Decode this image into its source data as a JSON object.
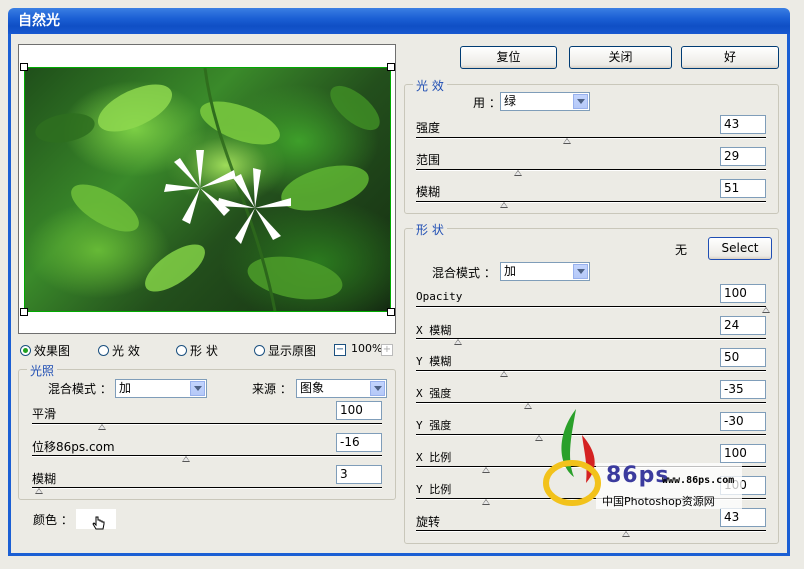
{
  "window": {
    "title": "自然光"
  },
  "buttons": {
    "reset": "复位",
    "close": "关闭",
    "ok": "好",
    "select": "Select"
  },
  "view_options": {
    "items": [
      "效果图",
      "光 效",
      "形 状",
      "显示原图"
    ],
    "selected": 0,
    "zoom": "100%"
  },
  "lighting": {
    "title": "光照",
    "blend_label": "混合模式 ：",
    "blend_value": "加",
    "source_label": "来源 ：",
    "source_value": "图象",
    "smooth_label": "平滑",
    "smooth_value": "100",
    "smooth_level": 0.2,
    "offset_label": "位移86ps.com",
    "offset_value": "-16",
    "offset_level": 0.44,
    "blur_label": "模糊",
    "blur_value": "3",
    "blur_level": 0.02
  },
  "color": {
    "label": "颜色 ：",
    "value": "#ffffff"
  },
  "light_effect": {
    "title": "光 效",
    "use_label": "用 ：",
    "use_value": "绿",
    "intensity_label": "强度",
    "intensity_value": "43",
    "intensity_level": 0.43,
    "range_label": "范围",
    "range_value": "29",
    "range_level": 0.29,
    "blur_label": "模糊",
    "blur_value": "51",
    "blur_level": 0.25
  },
  "shape": {
    "title": "形 状",
    "none_label": "无",
    "blend_label": "混合模式 ：",
    "blend_value": "加",
    "opacity_label": "Opacity",
    "opacity_value": "100",
    "opacity_level": 1.0,
    "xblur_label": "X 模糊",
    "xblur_value": "24",
    "xblur_level": 0.12,
    "yblur_label": "Y 模糊",
    "yblur_value": "50",
    "yblur_level": 0.25,
    "xint_label": "X 强度",
    "xint_value": "-35",
    "xint_level": 0.32,
    "yint_label": "Y 强度",
    "yint_value": "-30",
    "yint_level": 0.35,
    "xscale_label": "X 比例",
    "xscale_value": "100",
    "xscale_level": 0.2,
    "yscale_label": "Y 比例",
    "yscale_value": "100",
    "yscale_level": 0.2,
    "rotate_label": "旋转",
    "rotate_value": "43",
    "rotate_level": 0.6
  },
  "watermark": {
    "brand": "86ps",
    "url": "www.86ps.com",
    "caption": "中国Photoshop资源网"
  }
}
